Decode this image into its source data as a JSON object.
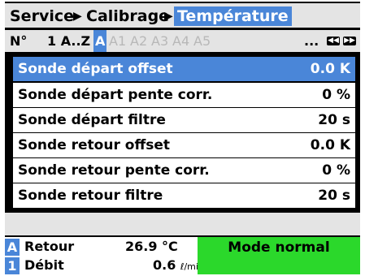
{
  "breadcrumb": {
    "items": [
      "Service",
      "Calibrage",
      "Température"
    ],
    "separator": "▶"
  },
  "index_bar": {
    "label": "N°",
    "range": "1 A..Z",
    "items": [
      "A",
      "A1",
      "A2",
      "A3",
      "A4",
      "A5"
    ],
    "selected": "A",
    "ellipsis": "...",
    "prev_icon": "skip-prev-icon",
    "next_icon": "skip-next-icon"
  },
  "rows": [
    {
      "label": "Sonde départ offset",
      "value": "0.0 K",
      "selected": true
    },
    {
      "label": "Sonde départ pente corr.",
      "value": "0 %"
    },
    {
      "label": "Sonde départ filtre",
      "value": "20 s"
    },
    {
      "label": "Sonde retour offset",
      "value": "0.0 K"
    },
    {
      "label": "Sonde retour pente corr.",
      "value": "0 %"
    },
    {
      "label": "Sonde retour filtre",
      "value": "20 s"
    }
  ],
  "status": {
    "channel_a": "A",
    "channel_1": "1",
    "retour_label": "Retour",
    "retour_value": "26.9 °C",
    "debit_label": "Débit",
    "debit_value": "0.6",
    "debit_unit": "ℓ/min",
    "mode": "Mode normal"
  },
  "colors": {
    "accent": "#4a86d8",
    "mode_bg": "#2bd82b",
    "bar_bg": "#e4e4e4"
  }
}
